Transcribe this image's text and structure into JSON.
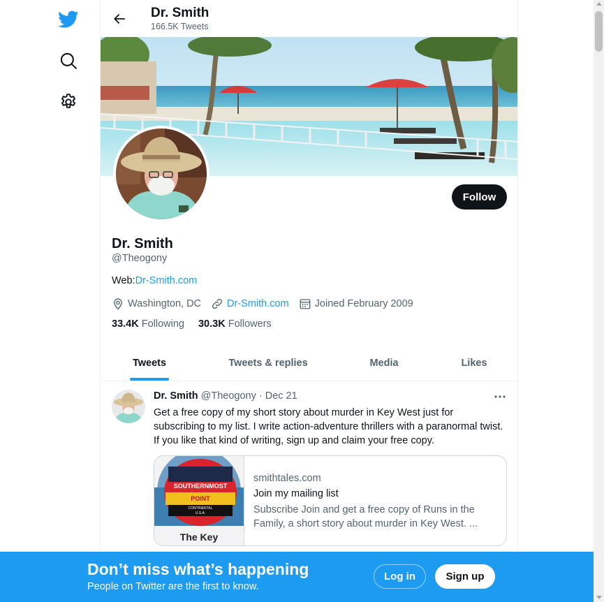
{
  "nav": {
    "items": [
      {
        "icon": "twitter-bird-icon",
        "color": "#1d9bf0"
      },
      {
        "icon": "search-icon"
      },
      {
        "icon": "gear-icon"
      }
    ]
  },
  "header": {
    "name": "Dr. Smith",
    "tweet_count": "166.5K Tweets"
  },
  "profile": {
    "name": "Dr. Smith",
    "handle": "@Theogony",
    "bio_prefix": "Web:",
    "bio_link": "Dr-Smith.com",
    "location": "Washington, DC",
    "website": "Dr-Smith.com",
    "joined": "Joined February 2009",
    "following_count": "33.4K",
    "following_label": "Following",
    "followers_count": "30.3K",
    "followers_label": "Followers",
    "follow_button": "Follow"
  },
  "tabs": [
    "Tweets",
    "Tweets & replies",
    "Media",
    "Likes"
  ],
  "active_tab": "Tweets",
  "tweet": {
    "author": "Dr. Smith",
    "handle": "@Theogony",
    "separator": "·",
    "date": "Dec 21",
    "text": "Get a free copy of my short story about murder in Key West just for subscribing to my list. I write action-adventure thrillers with a paranormal twist. If you like that kind of writing, sign up and claim your free copy.",
    "card": {
      "domain": "smithtales.com",
      "title": "Join my mailing list",
      "description": "Subscribe Join and get a free copy of Runs in the Family, a short story about murder in Key West. ...",
      "image_caption": "The Key",
      "image_buoy_lines": [
        "SOUTHERNMOST",
        "POINT",
        "CONTINENTAL",
        "U.S.A."
      ]
    }
  },
  "bottom_bar": {
    "title": "Don’t miss what’s happening",
    "subtitle": "People on Twitter are the first to know.",
    "login": "Log in",
    "signup": "Sign up",
    "color": "#1d9bf0"
  }
}
